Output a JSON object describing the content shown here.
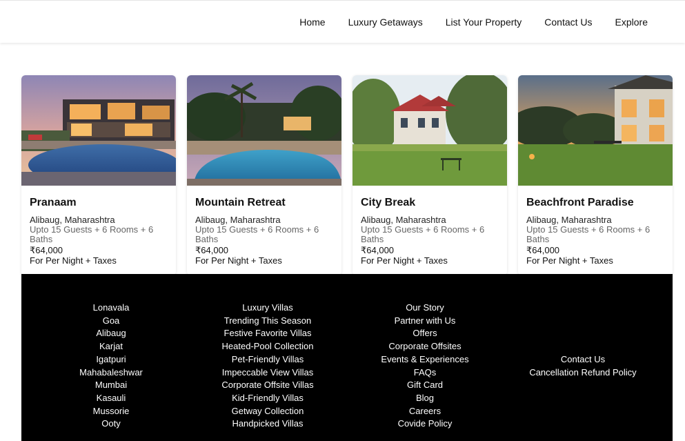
{
  "nav": {
    "items": [
      "Home",
      "Luxury Getaways",
      "List Your Property",
      "Contact Us",
      "Explore"
    ]
  },
  "cards": [
    {
      "name": "Pranaam",
      "location": "Alibaug, Maharashtra",
      "guests": "Upto 15 Guests + 6 Rooms + 6 Baths",
      "price": "₹64,000",
      "per": "For Per Night + Taxes"
    },
    {
      "name": "Mountain Retreat",
      "location": "Alibaug, Maharashtra",
      "guests": "Upto 15 Guests + 6 Rooms + 6 Baths",
      "price": "₹64,000",
      "per": "For Per Night + Taxes"
    },
    {
      "name": "City Break",
      "location": "Alibaug, Maharashtra",
      "guests": "Upto 15 Guests + 6 Rooms + 6 Baths",
      "price": "₹64,000",
      "per": "For Per Night + Taxes"
    },
    {
      "name": "Beachfront Paradise",
      "location": "Alibaug, Maharashtra",
      "guests": "Upto 15 Guests + 6 Rooms + 6 Baths",
      "price": "₹64,000",
      "per": "For Per Night + Taxes"
    }
  ],
  "footer": {
    "destinations": [
      "Lonavala",
      "Goa",
      "Alibaug",
      "Karjat",
      "Igatpuri",
      "Mahabaleshwar",
      "Mumbai",
      "Kasauli",
      "Mussorie",
      "Ooty"
    ],
    "collections": [
      "Luxury Villas",
      "Trending This Season",
      "Festive Favorite Villas",
      "Heated-Pool Collection",
      "Pet-Friendly Villas",
      "Impeccable View Villas",
      "Corporate Offsite Villas",
      "Kid-Friendly Villas",
      "Getway Collection",
      "Handpicked Villas"
    ],
    "company": [
      "Our Story",
      "Partner with Us",
      "Offers",
      "Corporate Offsites",
      "Events & Experiences",
      "FAQs",
      "Gift Card",
      "Blog",
      "Careers",
      "Covide Policy"
    ],
    "support": [
      "Contact Us",
      "Cancellation Refund Policy"
    ]
  },
  "colors": {
    "footer_bg": "#000000",
    "footer_text": "#ffffff",
    "muted_text": "#666666"
  }
}
